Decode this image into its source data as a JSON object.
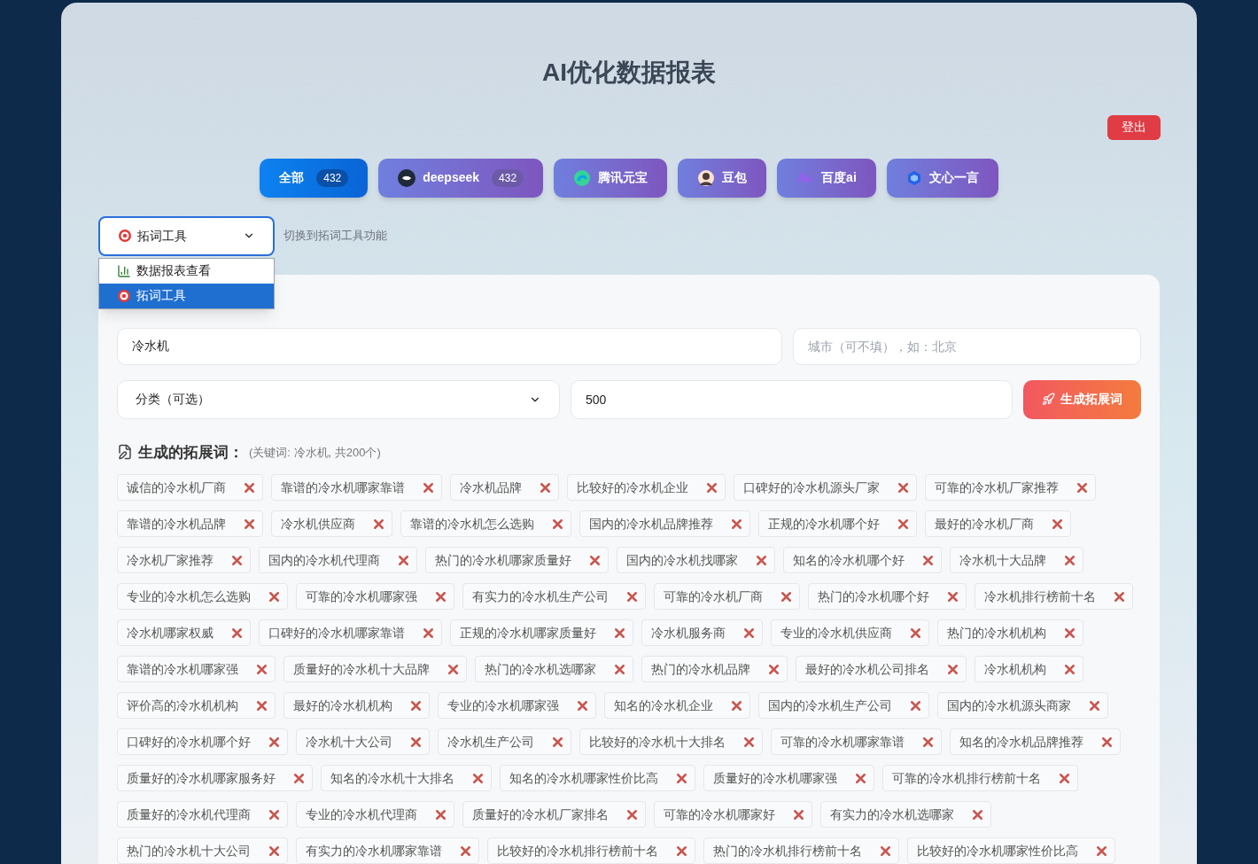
{
  "title": "AI优化数据报表",
  "logout": "登出",
  "tabs": [
    {
      "label": "全部",
      "count": "432",
      "selected": true,
      "kind": "none"
    },
    {
      "label": "deepseek",
      "count": "432",
      "selected": false,
      "kind": "whale"
    },
    {
      "label": "腾讯元宝",
      "selected": false,
      "kind": "swirl"
    },
    {
      "label": "豆包",
      "selected": false,
      "kind": "avatar"
    },
    {
      "label": "百度ai",
      "selected": false,
      "kind": "ai"
    },
    {
      "label": "文心一言",
      "selected": false,
      "kind": "cube"
    }
  ],
  "mode_select": {
    "value": "拓词工具",
    "expanded": true,
    "hint": "切换到拓词工具功能",
    "options": [
      {
        "label": "数据报表查看",
        "kind": "chart",
        "selected": false
      },
      {
        "label": "拓词工具",
        "kind": "target",
        "selected": true
      }
    ]
  },
  "form": {
    "keyword": {
      "value": "冷水机"
    },
    "city": {
      "placeholder": "城市（可不填），如：北京"
    },
    "category": {
      "value": "分类（可选）"
    },
    "count": {
      "value": "500"
    },
    "generate_button": "生成拓展词"
  },
  "results": {
    "heading": "生成的拓展词：",
    "summary": "(关键词: 冷水机, 共200个)",
    "keywords": [
      "诚信的冷水机厂商",
      "靠谱的冷水机哪家靠谱",
      "冷水机品牌",
      "比较好的冷水机企业",
      "口碑好的冷水机源头厂家",
      "可靠的冷水机厂家推荐",
      "靠谱的冷水机品牌",
      "冷水机供应商",
      "靠谱的冷水机怎么选购",
      "国内的冷水机品牌推荐",
      "正规的冷水机哪个好",
      "最好的冷水机厂商",
      "冷水机厂家推荐",
      "国内的冷水机代理商",
      "热门的冷水机哪家质量好",
      "国内的冷水机找哪家",
      "知名的冷水机哪个好",
      "冷水机十大品牌",
      "专业的冷水机怎么选购",
      "可靠的冷水机哪家强",
      "有实力的冷水机生产公司",
      "可靠的冷水机厂商",
      "热门的冷水机哪个好",
      "冷水机排行榜前十名",
      "冷水机哪家权威",
      "口碑好的冷水机哪家靠谱",
      "正规的冷水机哪家质量好",
      "冷水机服务商",
      "专业的冷水机供应商",
      "热门的冷水机机构",
      "靠谱的冷水机哪家强",
      "质量好的冷水机十大品牌",
      "热门的冷水机选哪家",
      "热门的冷水机品牌",
      "最好的冷水机公司排名",
      "冷水机机构",
      "评价高的冷水机机构",
      "最好的冷水机机构",
      "专业的冷水机哪家强",
      "知名的冷水机企业",
      "国内的冷水机生产公司",
      "国内的冷水机源头商家",
      "口碑好的冷水机哪个好",
      "冷水机十大公司",
      "冷水机生产公司",
      "比较好的冷水机十大排名",
      "可靠的冷水机哪家靠谱",
      "知名的冷水机品牌推荐",
      "质量好的冷水机哪家服务好",
      "知名的冷水机十大排名",
      "知名的冷水机哪家性价比高",
      "质量好的冷水机哪家强",
      "可靠的冷水机排行榜前十名",
      "质量好的冷水机代理商",
      "专业的冷水机代理商",
      "质量好的冷水机厂家排名",
      "可靠的冷水机哪家好",
      "有实力的冷水机选哪家",
      "热门的冷水机十大公司",
      "有实力的冷水机哪家靠谱",
      "比较好的冷水机排行榜前十名",
      "热门的冷水机排行榜前十名",
      "比较好的冷水机哪家性价比高"
    ]
  }
}
